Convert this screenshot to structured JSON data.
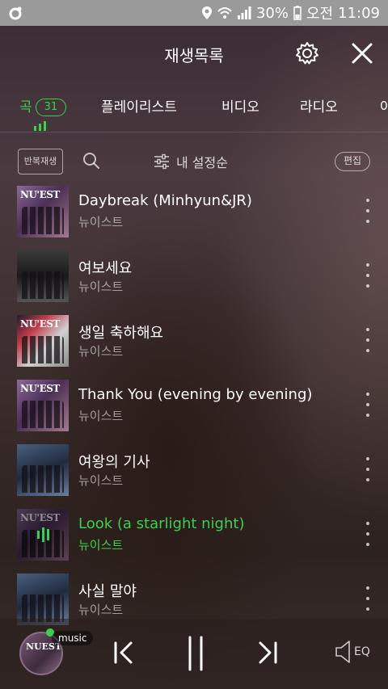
{
  "status": {
    "battery": "30%",
    "ampm": "오전",
    "time": "11:09"
  },
  "header": {
    "title": "재생목록"
  },
  "tabs": [
    {
      "label": "곡",
      "badge": "31",
      "active": true
    },
    {
      "label": "플레이리스트"
    },
    {
      "label": "비디오"
    },
    {
      "label": "라디오"
    },
    {
      "label": "아"
    }
  ],
  "toolbar": {
    "repeat_label": "반복재생",
    "sort_label": "내 설정순",
    "edit_label": "편집"
  },
  "songs": [
    {
      "title": "Daybreak (Minhyun&JR)",
      "artist": "뉴이스트",
      "art": "nuest-purple"
    },
    {
      "title": "여보세요",
      "artist": "뉴이스트",
      "art": "dark-group"
    },
    {
      "title": "생일 축하해요",
      "artist": "뉴이스트",
      "art": "nuest-station"
    },
    {
      "title": "Thank You (evening by evening)",
      "artist": "뉴이스트",
      "art": "nuest-purple"
    },
    {
      "title": "여왕의 기사",
      "artist": "뉴이스트",
      "art": "blue-group"
    },
    {
      "title": "Look (a starlight night)",
      "artist": "뉴이스트",
      "art": "nuest-purple",
      "playing": true
    },
    {
      "title": "사실 말야",
      "artist": "뉴이스트",
      "art": "blue-group"
    }
  ],
  "player": {
    "badge": "music",
    "eq_label": "EQ"
  },
  "colors": {
    "accent": "#3ccf4e"
  }
}
